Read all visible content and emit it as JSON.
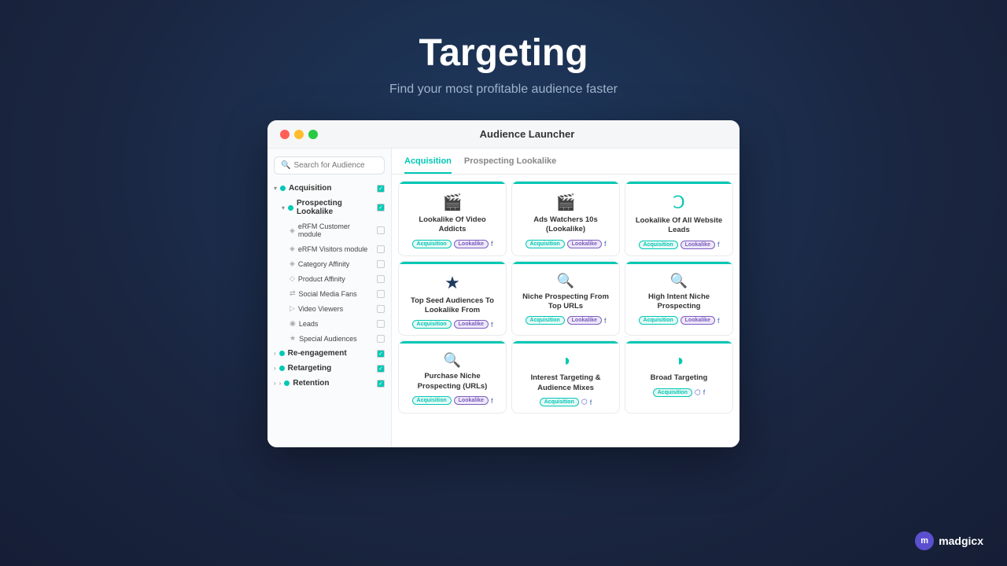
{
  "page": {
    "title": "Targeting",
    "subtitle": "Find your most profitable audience faster"
  },
  "window": {
    "title": "Audience Launcher",
    "dots": [
      "red",
      "yellow",
      "green"
    ]
  },
  "search": {
    "placeholder": "Search for Audience"
  },
  "tabs": [
    {
      "id": "acquisition",
      "label": "Acquisition",
      "active": true
    },
    {
      "id": "prospecting",
      "label": "Prospecting Lookalike",
      "active": false
    }
  ],
  "sidebar": {
    "items": [
      {
        "id": "acquisition",
        "label": "Acquisition",
        "level": 0,
        "checked": true,
        "indicator": "teal"
      },
      {
        "id": "prospecting-lookalike",
        "label": "Prospecting Lookalike",
        "level": 1,
        "checked": true,
        "indicator": "teal"
      },
      {
        "id": "erfm-customer",
        "label": "eRFM Customer module",
        "level": 2,
        "checked": false,
        "indicator": "blue"
      },
      {
        "id": "erfm-visitors",
        "label": "eRFM Visitors module",
        "level": 2,
        "checked": false,
        "indicator": "blue"
      },
      {
        "id": "category-affinity",
        "label": "Category Affinity",
        "level": 2,
        "checked": false,
        "indicator": "blue"
      },
      {
        "id": "product-affinity",
        "label": "Product Affinity",
        "level": 2,
        "checked": false,
        "indicator": "blue"
      },
      {
        "id": "social-media-fans",
        "label": "Social Media Fans",
        "level": 2,
        "checked": false,
        "indicator": "blue"
      },
      {
        "id": "video-viewers",
        "label": "Video Viewers",
        "level": 2,
        "checked": false,
        "indicator": "blue"
      },
      {
        "id": "leads",
        "label": "Leads",
        "level": 2,
        "checked": false,
        "indicator": "blue"
      },
      {
        "id": "special-audiences",
        "label": "Special Audiences",
        "level": 2,
        "checked": false,
        "indicator": "blue"
      },
      {
        "id": "re-engagement",
        "label": "Re-engagement",
        "level": 0,
        "checked": true,
        "indicator": "teal"
      },
      {
        "id": "retargeting",
        "label": "Retargeting",
        "level": 0,
        "checked": true,
        "indicator": "teal"
      },
      {
        "id": "retention",
        "label": "Retention",
        "level": 0,
        "checked": true,
        "indicator": "teal"
      }
    ]
  },
  "cards": [
    {
      "id": "lookalike-video",
      "title": "Lookalike Of Video Addicts",
      "icon": "video",
      "tags": [
        "Acquisition",
        "Lookalike"
      ],
      "fb": true
    },
    {
      "id": "ads-watchers",
      "title": "Ads Watchers 10s (Lookalike)",
      "icon": "video",
      "tags": [
        "Acquisition",
        "Lookalike"
      ],
      "fb": true
    },
    {
      "id": "lookalike-all",
      "title": "Lookalike Of All Website Leads",
      "icon": "c",
      "tags": [
        "Acquisition",
        "Lookalike"
      ],
      "fb": true
    },
    {
      "id": "top-seed",
      "title": "Top Seed Audiences To Lookalike From",
      "icon": "star",
      "tags": [
        "Acquisition",
        "Lookalike"
      ],
      "fb": true
    },
    {
      "id": "niche-urls",
      "title": "Niche Prospecting From Top URLs",
      "icon": "search",
      "tags": [
        "Acquisition",
        "Lookalike"
      ],
      "fb": true
    },
    {
      "id": "high-intent",
      "title": "High Intent Niche Prospecting",
      "icon": "search",
      "tags": [
        "Acquisition",
        "Lookalike"
      ],
      "fb": true
    },
    {
      "id": "purchase-niche",
      "title": "Purchase Niche Prospecting (URLs)",
      "icon": "search",
      "tags": [
        "Acquisition",
        "Lookalike"
      ],
      "fb": true
    },
    {
      "id": "interest-targeting",
      "title": "Interest Targeting & Audience Mixes",
      "icon": "pie",
      "tags": [
        "Acquisition"
      ],
      "fb": true,
      "extra_icons": [
        "madgicx",
        "fb"
      ]
    },
    {
      "id": "broad-targeting",
      "title": "Broad Targeting",
      "icon": "pie",
      "tags": [
        "Acquisition"
      ],
      "fb": true,
      "extra_icons": [
        "madgicx",
        "fb"
      ]
    }
  ],
  "logo": {
    "text": "madgicx",
    "icon_label": "m"
  }
}
